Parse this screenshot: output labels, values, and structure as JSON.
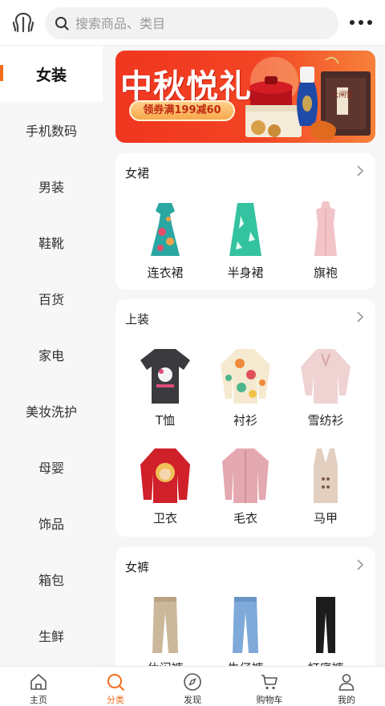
{
  "search": {
    "placeholder": "搜索商品、类目"
  },
  "sidebar": {
    "items": [
      {
        "label": "女装"
      },
      {
        "label": "手机数码"
      },
      {
        "label": "男装"
      },
      {
        "label": "鞋靴"
      },
      {
        "label": "百货"
      },
      {
        "label": "家电"
      },
      {
        "label": "美妆洗护"
      },
      {
        "label": "母婴"
      },
      {
        "label": "饰品"
      },
      {
        "label": "箱包"
      },
      {
        "label": "生鲜"
      }
    ],
    "active_index": 0
  },
  "banner": {
    "title": "中秋悦礼",
    "coupon": "领券满199减60",
    "box_text": "大闸蟹"
  },
  "sections": [
    {
      "title": "女裙",
      "items": [
        {
          "label": "连衣裙"
        },
        {
          "label": "半身裙"
        },
        {
          "label": "旗袍"
        }
      ]
    },
    {
      "title": "上装",
      "items": [
        {
          "label": "T恤"
        },
        {
          "label": "衬衫"
        },
        {
          "label": "雪纺衫"
        },
        {
          "label": "卫衣"
        },
        {
          "label": "毛衣"
        },
        {
          "label": "马甲"
        }
      ]
    },
    {
      "title": "女裤",
      "items": [
        {
          "label": "休闲裤"
        },
        {
          "label": "牛仔裤"
        },
        {
          "label": "打底裤"
        }
      ]
    }
  ],
  "nav": {
    "items": [
      {
        "label": "主页",
        "icon": "home-icon"
      },
      {
        "label": "分类",
        "icon": "search-icon"
      },
      {
        "label": "发现",
        "icon": "compass-icon"
      },
      {
        "label": "购物车",
        "icon": "cart-icon"
      },
      {
        "label": "我的",
        "icon": "user-icon"
      }
    ],
    "active_index": 1
  },
  "colors": {
    "accent": "#f26c1c",
    "banner_red": "#f0361f"
  }
}
